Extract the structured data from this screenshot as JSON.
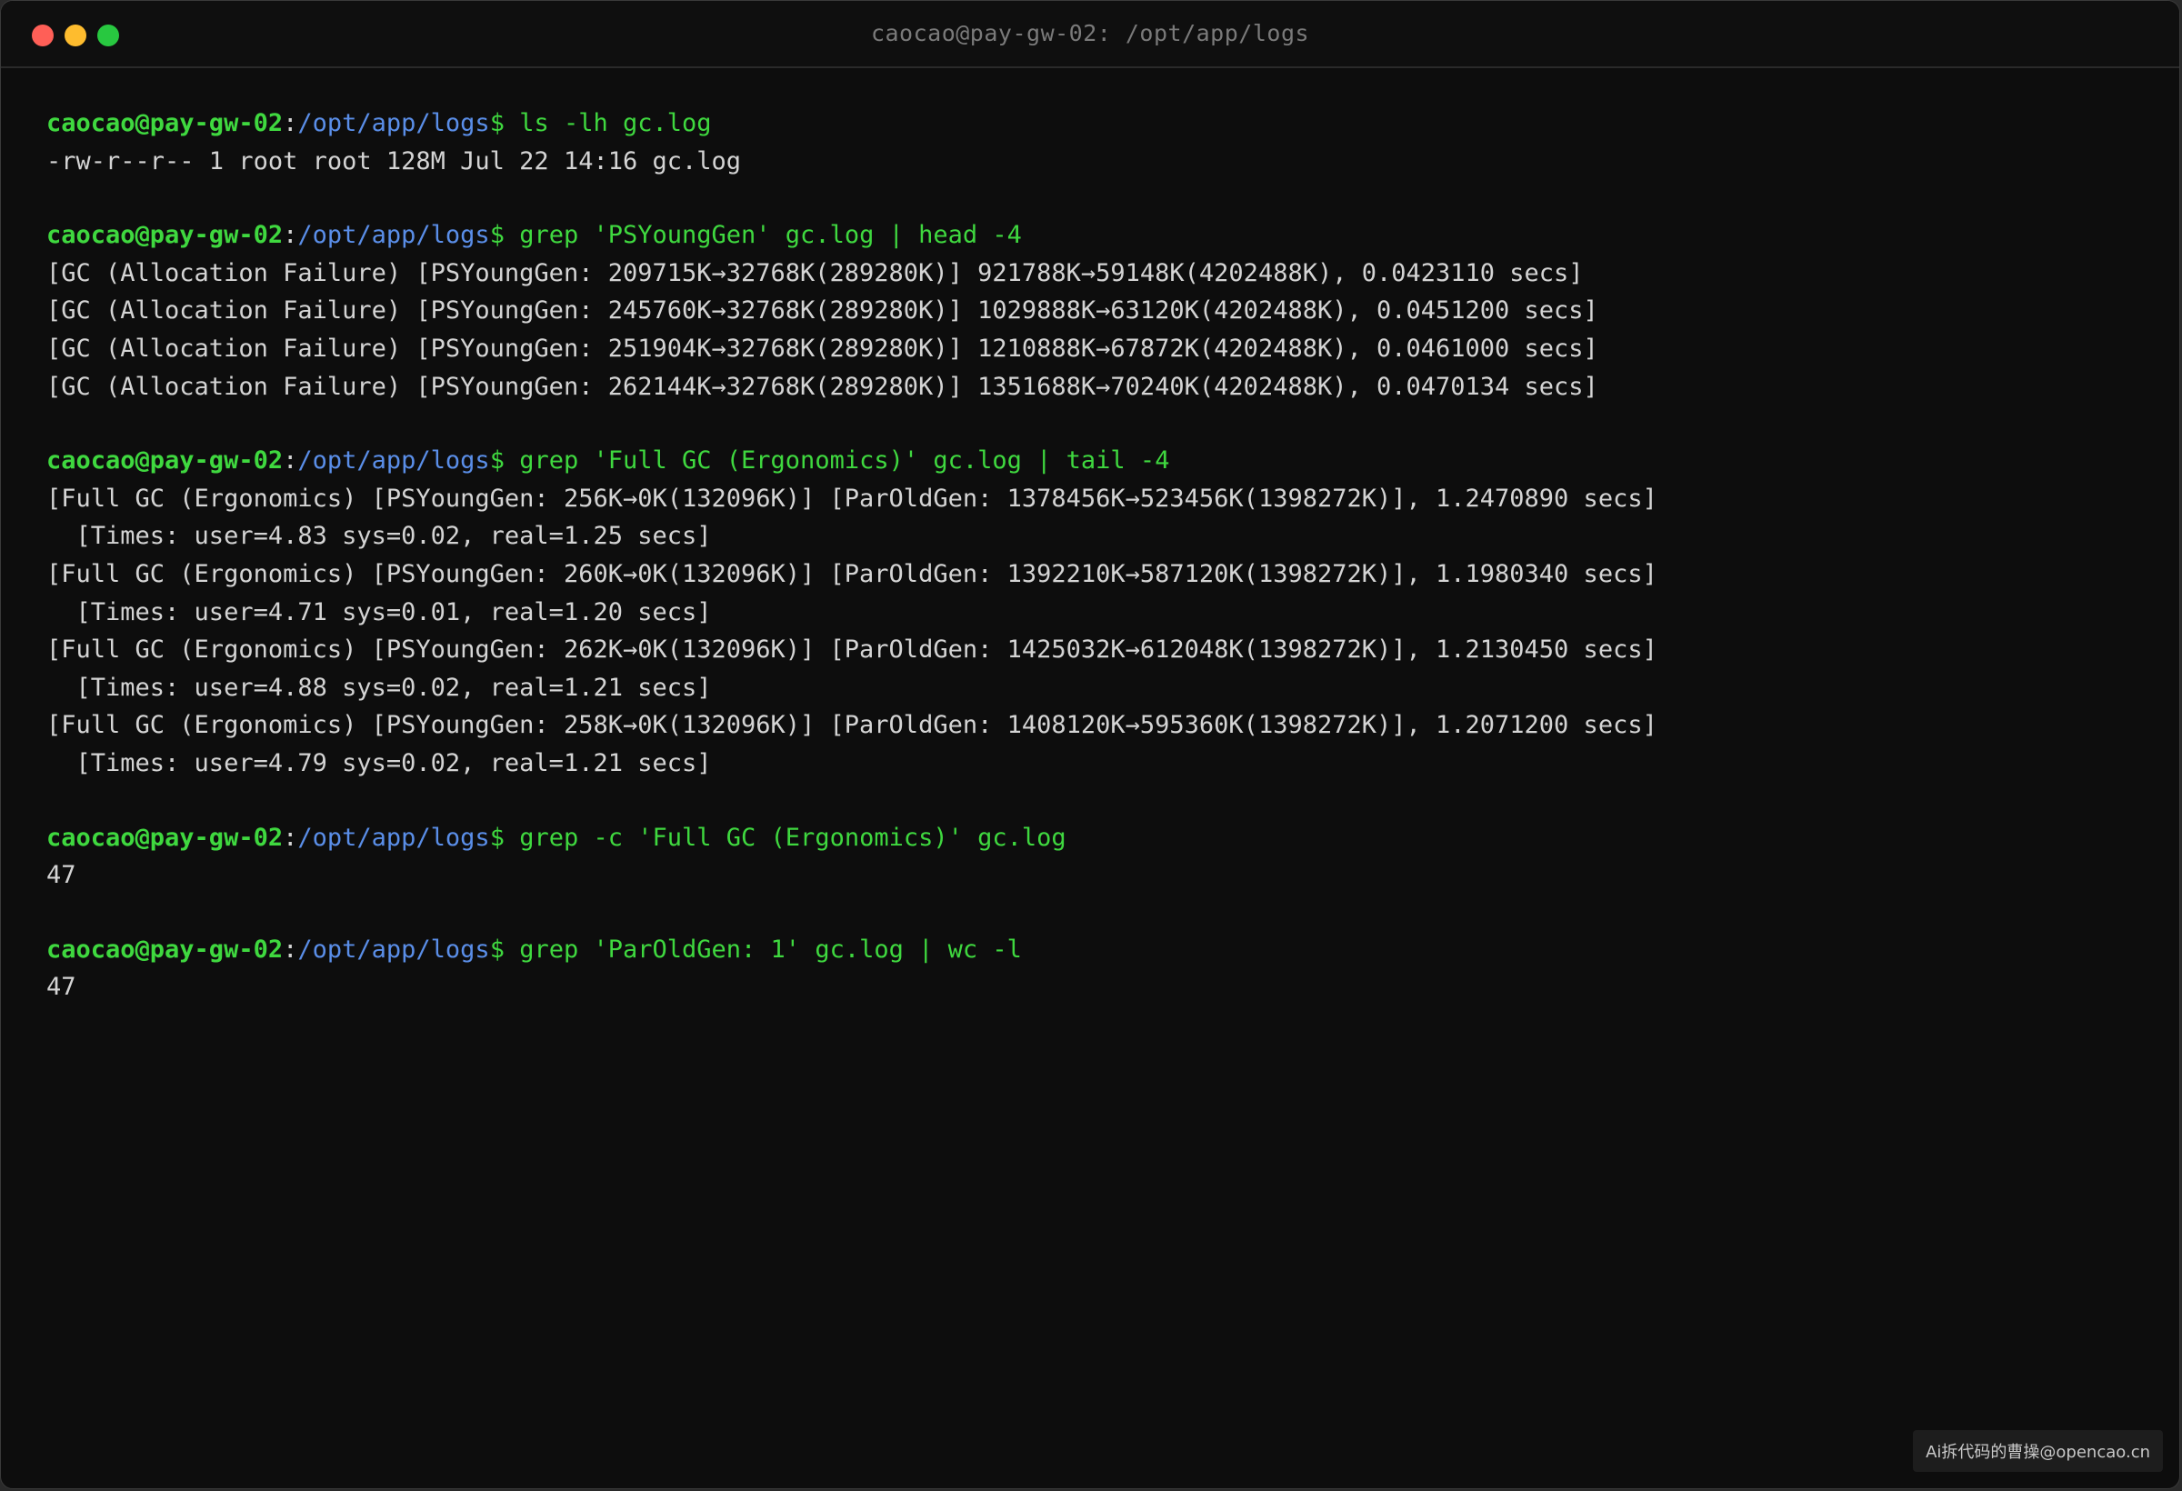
{
  "window": {
    "title": "caocao@pay-gw-02: /opt/app/logs"
  },
  "prompt": {
    "user_host": "caocao@pay-gw-02",
    "colon": ":",
    "path": "/opt/app/logs",
    "dollar": "$"
  },
  "blocks": [
    {
      "command": " ls -lh gc.log",
      "output": [
        "-rw-r--r-- 1 root root 128M Jul 22 14:16 gc.log"
      ]
    },
    {
      "command": " grep 'PSYoungGen' gc.log | head -4",
      "output": [
        "[GC (Allocation Failure) [PSYoungGen: 209715K->32768K(289280K)] 921788K->59148K(4202488K), 0.0423110 secs]",
        "[GC (Allocation Failure) [PSYoungGen: 245760K->32768K(289280K)] 1029888K->63120K(4202488K), 0.0451200 secs]",
        "[GC (Allocation Failure) [PSYoungGen: 251904K->32768K(289280K)] 1210888K->67872K(4202488K), 0.0461000 secs]",
        "[GC (Allocation Failure) [PSYoungGen: 262144K->32768K(289280K)] 1351688K->70240K(4202488K), 0.0470134 secs]"
      ]
    },
    {
      "command": " grep 'Full GC (Ergonomics)' gc.log | tail -4",
      "output": [
        "[Full GC (Ergonomics) [PSYoungGen: 256K->0K(132096K)] [ParOldGen: 1378456K->523456K(1398272K)], 1.2470890 secs]",
        "  [Times: user=4.83 sys=0.02, real=1.25 secs]",
        "[Full GC (Ergonomics) [PSYoungGen: 260K->0K(132096K)] [ParOldGen: 1392210K->587120K(1398272K)], 1.1980340 secs]",
        "  [Times: user=4.71 sys=0.01, real=1.20 secs]",
        "[Full GC (Ergonomics) [PSYoungGen: 262K->0K(132096K)] [ParOldGen: 1425032K->612048K(1398272K)], 1.2130450 secs]",
        "  [Times: user=4.88 sys=0.02, real=1.21 secs]",
        "[Full GC (Ergonomics) [PSYoungGen: 258K->0K(132096K)] [ParOldGen: 1408120K->595360K(1398272K)], 1.2071200 secs]",
        "  [Times: user=4.79 sys=0.02, real=1.21 secs]"
      ]
    },
    {
      "command": " grep -c 'Full GC (Ergonomics)' gc.log",
      "output": [
        "47"
      ]
    },
    {
      "command": " grep 'ParOldGen: 1' gc.log | wc -l",
      "output": [
        "47"
      ]
    }
  ],
  "watermark": "Ai拆代码的曹操@opencao.cn",
  "colors": {
    "background": "#0d0d0d",
    "prompt_green": "#3fd83f",
    "path_blue": "#5a8ee8",
    "output_text": "#d4d4d4"
  }
}
